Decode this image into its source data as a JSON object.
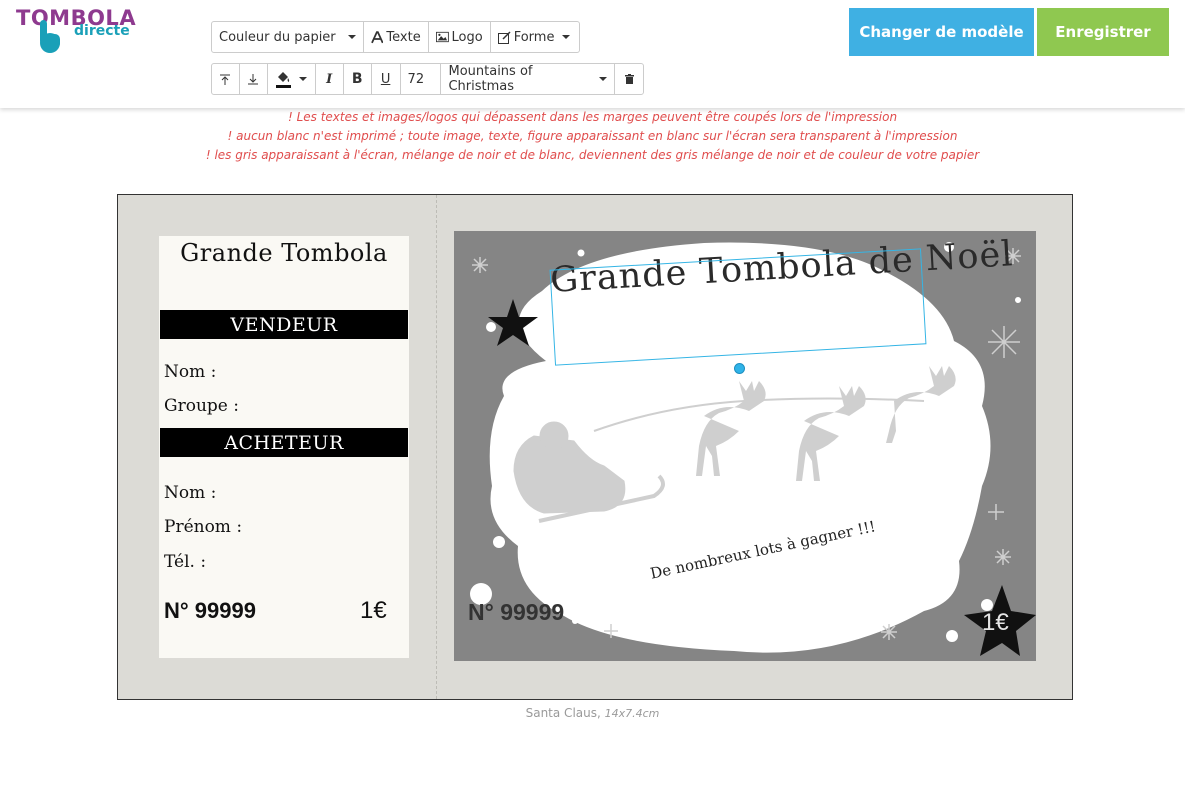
{
  "brand": {
    "line1": "TOMBOLA",
    "line2": "directe",
    "color_primary": "#8e3a8f",
    "color_secondary": "#1aa0b8"
  },
  "toolbar": {
    "paper_color_label": "Couleur du papier",
    "text_label": "Texte",
    "logo_label": "Logo",
    "shape_label": "Forme",
    "font_size": "72",
    "font_family": "Mountains of Christmas"
  },
  "actions": {
    "change_model": "Changer de modèle",
    "save": "Enregistrer",
    "change_color": "#3fb0e3",
    "save_color": "#8fc850"
  },
  "warnings": [
    "! Les textes et images/logos qui dépassent dans les marges peuvent être coupés lors de l'impression",
    "! aucun blanc n'est imprimé ; toute image, texte, figure apparaissant en blanc sur l'écran sera transparent à l'impression",
    "! les gris apparaissant à l'écran, mélange de noir et de blanc, deviennent des gris mélange de noir et de couleur de votre papier"
  ],
  "stub": {
    "title": "Grande Tombola",
    "seller_header": "VENDEUR",
    "seller_fields": [
      "Nom :",
      "Groupe :"
    ],
    "buyer_header": "ACHETEUR",
    "buyer_fields": [
      "Nom :",
      "Prénom :",
      "Tél. :"
    ],
    "number": "N° 99999",
    "price": "1€"
  },
  "main": {
    "title": "Grande Tombola de Noël",
    "subtitle": "De nombreux lots à gagner !!!",
    "number": "N° 99999",
    "price": "1€"
  },
  "caption": {
    "model": "Santa Claus,",
    "size": "14x7.4cm"
  }
}
